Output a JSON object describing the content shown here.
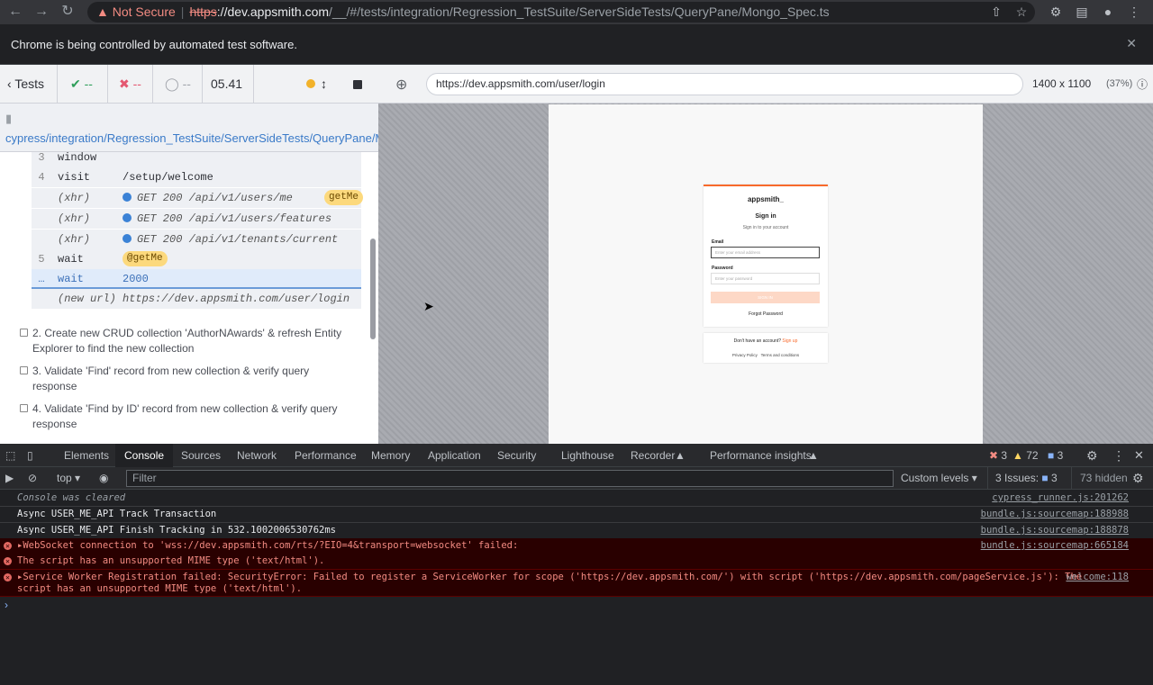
{
  "browser": {
    "not_secure": "Not Secure",
    "url_scheme": "https",
    "url_host": "://dev.appsmith.com",
    "url_path": "/__/#/tests/integration/Regression_TestSuite/ServerSideTests/QueryPane/Mongo_Spec.ts",
    "infobar_text": "Chrome is being controlled by automated test software."
  },
  "runner": {
    "tests_label": "Tests",
    "passed": "--",
    "failed": "--",
    "pending": "--",
    "duration": "05.41",
    "spec_path": "cypress/integration/Regression_TestSuite/ServerSideTests/QueryPane/Mongo_Spec.ts",
    "commands": [
      {
        "num": "3",
        "name": "window",
        "msg": ""
      },
      {
        "num": "4",
        "name": "visit",
        "msg": "/setup/welcome"
      },
      {
        "num": "",
        "name": "(xhr)",
        "msg": "GET 200 /api/v1/users/me",
        "alias": "getMe"
      },
      {
        "num": "",
        "name": "(xhr)",
        "msg": "GET 200 /api/v1/users/features"
      },
      {
        "num": "",
        "name": "(xhr)",
        "msg": "GET 200 /api/v1/tenants/current"
      },
      {
        "num": "5",
        "name": "wait",
        "msg": "@getMe"
      },
      {
        "num": "",
        "name": "wait",
        "msg": "2000"
      },
      {
        "num": "",
        "name": "(new url)",
        "msg": "https://dev.appsmith.com/user/login"
      }
    ],
    "tests": [
      "2. Create new CRUD collection 'AuthorNAwards' & refresh Entity Explorer to find the new collection",
      "3. Validate 'Find' record from new collection & verify query response",
      "4. Validate 'Find by ID' record from new collection & verify query response"
    ],
    "aut_url": "https://dev.appsmith.com/user/login",
    "viewport_size": "1400 x 1100",
    "viewport_scale": "(37%)"
  },
  "app": {
    "logo": "appsmith_",
    "signin_title": "Sign in",
    "signin_subtitle": "Sign in to your account",
    "email_label": "Email",
    "email_placeholder": "Enter your email address",
    "password_label": "Password",
    "password_placeholder": "Enter your password",
    "signin_button": "SIGN IN",
    "forgot": "Forgot Password",
    "no_account": "Don't have an account?",
    "signup": "Sign up",
    "privacy": "Privacy Policy",
    "terms": "Terms and conditions"
  },
  "devtools": {
    "tabs": [
      "Elements",
      "Console",
      "Sources",
      "Network",
      "Performance",
      "Memory",
      "Application",
      "Security",
      "Lighthouse",
      "Recorder",
      "Performance insights"
    ],
    "error_count": "3",
    "warning_count": "72",
    "message_count": "3",
    "context": "top",
    "filter_placeholder": "Filter",
    "levels": "Custom levels",
    "issues": "3 Issues:",
    "issues_count": "3",
    "hidden": "73 hidden",
    "lines": [
      {
        "text": "Console was cleared",
        "src": "cypress_runner.js:201262",
        "type": "info"
      },
      {
        "text": "Async USER_ME_API Track Transaction",
        "src": "bundle.js:sourcemap:188988",
        "type": "log"
      },
      {
        "text": "Async USER_ME_API Finish Tracking in 532.1002006530762ms",
        "src": "bundle.js:sourcemap:188878",
        "type": "log"
      },
      {
        "text": "WebSocket connection to 'wss://dev.appsmith.com/rts/?EIO=4&transport=websocket' failed:",
        "src": "bundle.js:sourcemap:665184",
        "type": "error"
      },
      {
        "text": "The script has an unsupported MIME type ('text/html').",
        "src": "",
        "type": "error"
      },
      {
        "text": "Service Worker Registration failed: SecurityError: Failed to register a ServiceWorker for scope ('https://dev.appsmith.com/') with script ('https://dev.appsmith.com/pageService.js'): The",
        "text2": "script has an unsupported MIME type ('text/html').",
        "src": "welcome:118",
        "type": "error"
      }
    ]
  }
}
